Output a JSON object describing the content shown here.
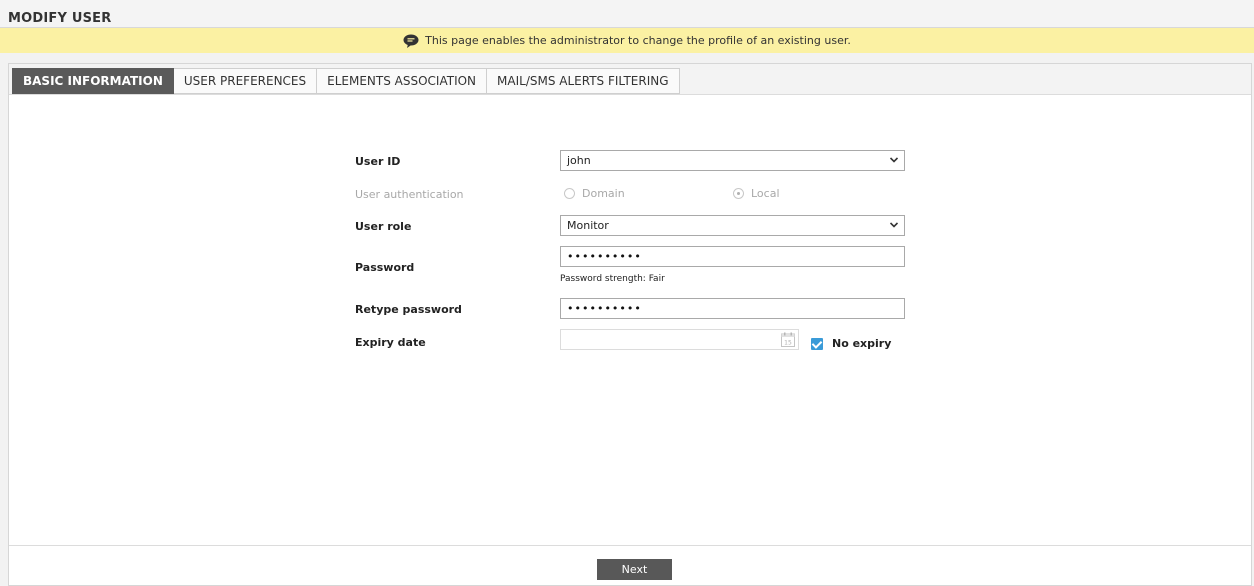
{
  "header": {
    "title": "MODIFY USER"
  },
  "banner": {
    "text": "This page enables the administrator to change the profile of an existing user.",
    "icon": "speech-bubble-icon"
  },
  "tabs": [
    {
      "label": "BASIC INFORMATION",
      "active": true
    },
    {
      "label": "USER PREFERENCES",
      "active": false
    },
    {
      "label": "ELEMENTS ASSOCIATION",
      "active": false
    },
    {
      "label": "MAIL/SMS ALERTS FILTERING",
      "active": false
    }
  ],
  "form": {
    "user_id": {
      "label": "User ID",
      "value": "john"
    },
    "user_auth": {
      "label": "User authentication",
      "options": [
        {
          "label": "Domain",
          "selected": false
        },
        {
          "label": "Local",
          "selected": true
        }
      ]
    },
    "user_role": {
      "label": "User role",
      "value": "Monitor"
    },
    "password": {
      "label": "Password",
      "value": "••••••••••",
      "strength": "Password strength: Fair"
    },
    "retype_password": {
      "label": "Retype password",
      "value": "••••••••••"
    },
    "expiry_date": {
      "label": "Expiry date",
      "value": "",
      "calendar_day": "15",
      "no_expiry_label": "No expiry",
      "no_expiry_checked": true
    }
  },
  "actions": {
    "next_label": "Next"
  },
  "colors": {
    "banner_bg": "#fbf1a3",
    "active_tab_bg": "#5a5a5a",
    "checkbox_accent": "#3a9bd8",
    "button_bg": "#585858"
  }
}
